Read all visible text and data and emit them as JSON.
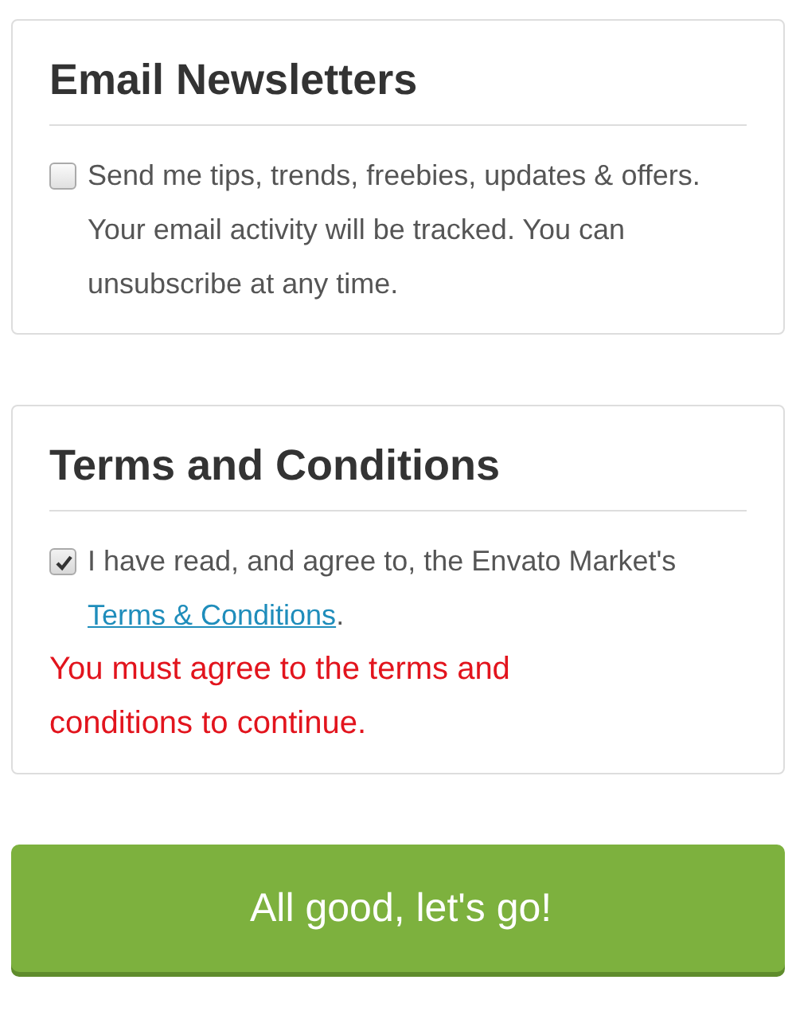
{
  "sections": [
    {
      "title": "Email Newsletters",
      "checkbox": {
        "checked": false,
        "text": "Send me tips, trends, freebies, updates & offers. Your email activity will be tracked. You can unsubscribe at any time."
      }
    },
    {
      "title": "Terms and Conditions",
      "checkbox": {
        "checked": true,
        "text": "I have read, and agree to, the Envato Market's",
        "link": "Terms & Conditions",
        "after": "."
      },
      "error": "You must agree to the terms and conditions to continue."
    }
  ],
  "submit_button": "All good, let's go!"
}
